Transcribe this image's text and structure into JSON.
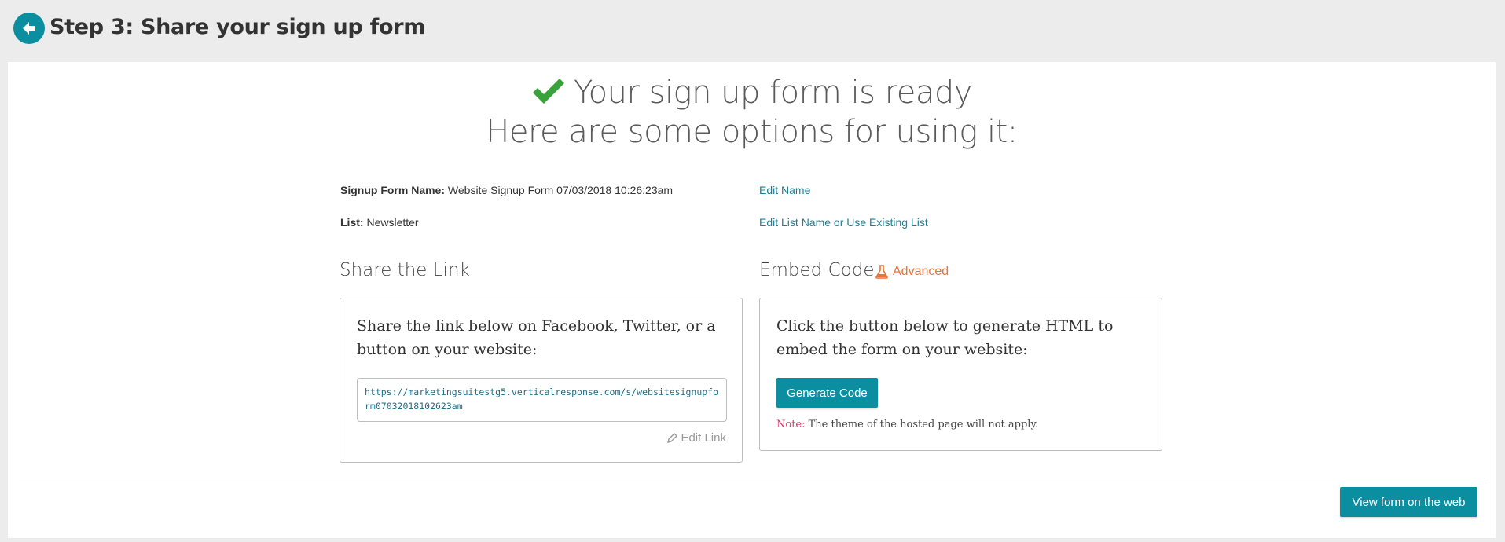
{
  "header": {
    "title": "Step 3: Share your sign up form",
    "back_icon": "arrow-left-icon"
  },
  "hero": {
    "line1": "Your sign up form is ready",
    "line2": "Here are some options for using it:",
    "check_icon": "check-icon",
    "check_color": "#3aa23a"
  },
  "info": {
    "form_name_label": "Signup Form Name:",
    "form_name_value": "Website Signup Form 07/03/2018 10:26:23am",
    "edit_name": "Edit Name",
    "list_label": "List:",
    "list_value": "Newsletter",
    "edit_list": "Edit List Name or Use Existing List"
  },
  "share": {
    "title": "Share the Link",
    "description": "Share the link below on Facebook, Twitter, or a button on your website:",
    "url": "https://marketingsuitestg5.verticalresponse.com/s/websitesignupform07032018102623am",
    "edit_link": "Edit Link"
  },
  "embed": {
    "title": "Embed Code",
    "advanced_label": "Advanced",
    "advanced_color": "#e8743b",
    "description": "Click the button below to generate HTML to embed the form on your website:",
    "generate_button": "Generate Code",
    "note_label": "Note:",
    "note_text": " The theme of the hosted page will not apply."
  },
  "footer": {
    "view_button": "View form on the web"
  },
  "colors": {
    "accent": "#0a8ea0",
    "link": "#1c7f96"
  }
}
